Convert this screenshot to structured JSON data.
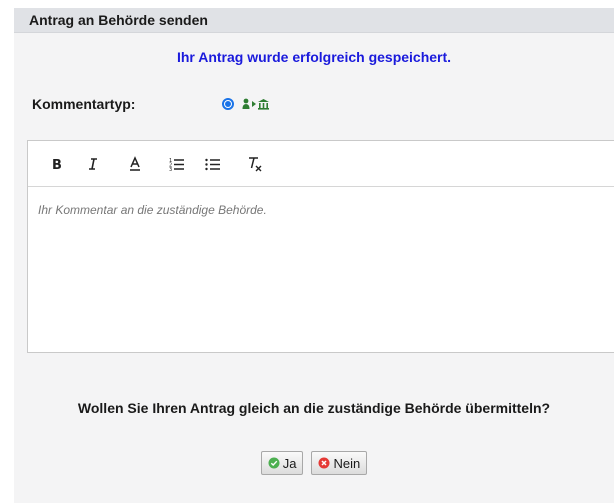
{
  "dialog": {
    "title": "Antrag an Behörde senden",
    "success_message": "Ihr Antrag wurde erfolgreich gespeichert.",
    "comment_type_label": "Kommentartyp:",
    "comment_type_icon": "person-to-authority-icon",
    "editor": {
      "placeholder": "Ihr Kommentar an die zuständige Behörde.",
      "toolbar": [
        "bold-icon",
        "italic-icon",
        "font-color-icon",
        "ordered-list-icon",
        "bullet-list-icon",
        "clear-format-icon"
      ]
    },
    "question": "Wollen Sie Ihren Antrag gleich an die zuständige Behörde übermitteln?",
    "buttons": {
      "yes": "Ja",
      "no": "Nein"
    }
  },
  "colors": {
    "success_text": "#1a1adc",
    "title_bar": "#e0e2e6",
    "yes_icon": "#4caf50",
    "no_icon": "#e53935"
  }
}
